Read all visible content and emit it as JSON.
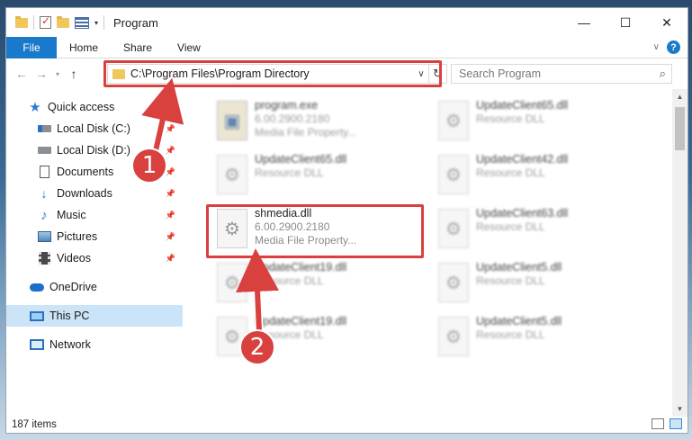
{
  "window": {
    "title": "Program",
    "controls": {
      "minimize": "—",
      "maximize": "☐",
      "close": "✕"
    }
  },
  "ribbon": {
    "file_tab": "File",
    "tabs": [
      "Home",
      "Share",
      "View"
    ],
    "help": "?",
    "chevron": "∨"
  },
  "nav": {
    "address": "C:\\Program Files\\Program Directory",
    "search_placeholder": "Search Program"
  },
  "sidebar": {
    "items": [
      {
        "label": "Quick access",
        "icon": "star-icon"
      },
      {
        "label": "Local Disk (C:)",
        "icon": "drive-icon",
        "pinned": true
      },
      {
        "label": "Local Disk (D:)",
        "icon": "drive-icon",
        "pinned": true
      },
      {
        "label": "Documents",
        "icon": "documents-icon",
        "pinned": true
      },
      {
        "label": "Downloads",
        "icon": "download-icon",
        "pinned": true
      },
      {
        "label": "Music",
        "icon": "music-icon",
        "pinned": true
      },
      {
        "label": "Pictures",
        "icon": "pictures-icon",
        "pinned": true
      },
      {
        "label": "Videos",
        "icon": "videos-icon",
        "pinned": true
      },
      {
        "label": "OneDrive",
        "icon": "cloud-icon"
      },
      {
        "label": "This PC",
        "icon": "computer-icon",
        "selected": true
      },
      {
        "label": "Network",
        "icon": "network-icon"
      }
    ]
  },
  "files": [
    {
      "name": "program.exe",
      "line2": "6.00.2900.2180",
      "line3": "Media File Property...",
      "icon": "exe-icon"
    },
    {
      "name": "UpdateClient65.dll",
      "line2": "Resource DLL",
      "icon": "dll-icon"
    },
    {
      "name": "UpdateClient42.dll",
      "line2": "Resource DLL",
      "icon": "dll-icon"
    },
    {
      "name": "shmedia.dll",
      "line2": "6.00.2900.2180",
      "line3": "Media File Property...",
      "icon": "dll-icon",
      "highlighted": true
    },
    {
      "name": "UpdateClient63.dll",
      "line2": "Resource DLL",
      "icon": "dll-icon"
    },
    {
      "name": "UpdateClient19.dll",
      "line2": "Resource DLL",
      "icon": "dll-icon"
    },
    {
      "name": "UpdateClient5.dll",
      "line2": "Resource DLL",
      "icon": "dll-icon"
    },
    {
      "name": "UpdateClient19.dll",
      "line2": "Resource DLL",
      "icon": "dll-icon"
    },
    {
      "name": "UpdateClient5.dll",
      "line2": "Resource DLL",
      "icon": "dll-icon"
    },
    {
      "name": "UpdateClient65.dll",
      "line2": "Resource DLL",
      "icon": "dll-icon"
    }
  ],
  "status": {
    "items": "187 items"
  },
  "callouts": {
    "one": "1",
    "two": "2"
  },
  "colors": {
    "accent": "#1979ca",
    "highlight": "#d9413e",
    "selected_bg": "#cce4f7"
  }
}
